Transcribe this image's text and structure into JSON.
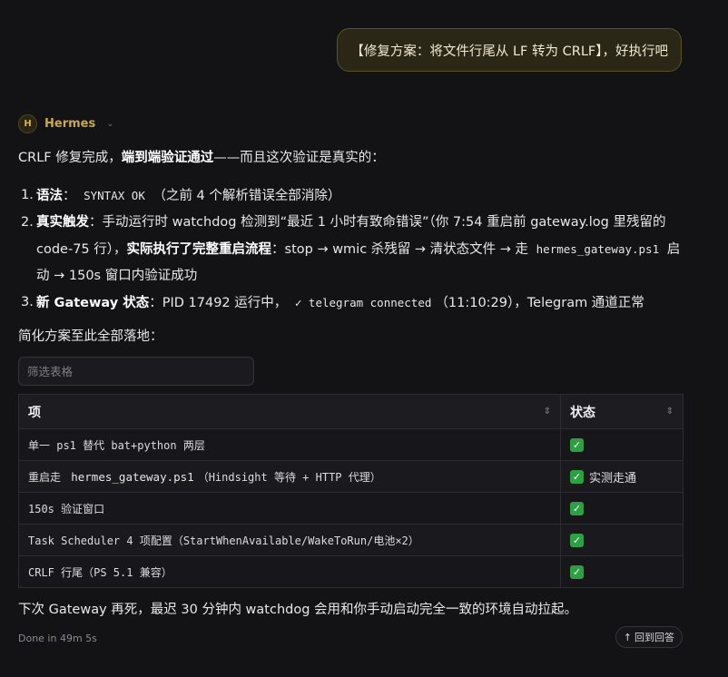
{
  "user_message": "【修复方案：将文件行尾从 LF 转为 CRLF】，好执行吧",
  "assistant": {
    "avatar_letter": "H",
    "name": "Hermes"
  },
  "intro": {
    "a": "CRLF 修复完成，",
    "b": "端到端验证通过",
    "c": "——而且这次验证是真实的："
  },
  "steps": [
    {
      "num": "1.",
      "title": "语法",
      "sep": "：",
      "code": "SYNTAX OK",
      "rest": "（之前 4 个解析错误全部消除）"
    },
    {
      "num": "2.",
      "title": "真实触发",
      "sep": "：",
      "a": "手动运行时 watchdog 检测到“最近 1 小时有致命错误”（你 7:54 重启前 gateway.log 里残留的 code-75 行），",
      "b": "实际执行了完整重启流程",
      "c": "：stop → wmic 杀残留 → 清状态文件 → 走",
      "code": "hermes_gateway.ps1",
      "d": " 启动 → 150s 窗口内验证成功"
    },
    {
      "num": "3.",
      "title": "新 Gateway 状态",
      "sep": "：",
      "a": "PID 17492 运行中，",
      "code": "✓ telegram connected",
      "b": "（11:10:29），Telegram 通道正常"
    }
  ],
  "summary_text": "简化方案至此全部落地：",
  "filter": {
    "placeholder": "筛选表格",
    "value": ""
  },
  "table": {
    "headers": [
      "项",
      "状态"
    ],
    "rows": [
      {
        "item": "单一 ps1 替代 bat+python 两层",
        "check": "✓",
        "status_text": ""
      },
      {
        "item_a": "重启走 ",
        "item_code": "hermes_gateway.ps1",
        "item_b": "（Hindsight 等待 + HTTP 代理）",
        "check": "✓",
        "status_text": "实测走通"
      },
      {
        "item": "150s 验证窗口",
        "check": "✓",
        "status_text": ""
      },
      {
        "item": "Task Scheduler 4 项配置（StartWhenAvailable/WakeToRun/电池×2）",
        "check": "✓",
        "status_text": ""
      },
      {
        "item": "CRLF 行尾（PS 5.1 兼容）",
        "check": "✓",
        "status_text": ""
      }
    ]
  },
  "closing_text": "下次 Gateway 再死，最迟 30 分钟内 watchdog 会用和你手动启动完全一致的环境自动拉起。",
  "footer": {
    "meta": "Done in 49m 5s",
    "back_arrow": "↑",
    "back_label": "回到回答"
  },
  "colors": {
    "accent_gold": "#c9a94a",
    "check_green": "#2ea043",
    "background": "#131316"
  }
}
